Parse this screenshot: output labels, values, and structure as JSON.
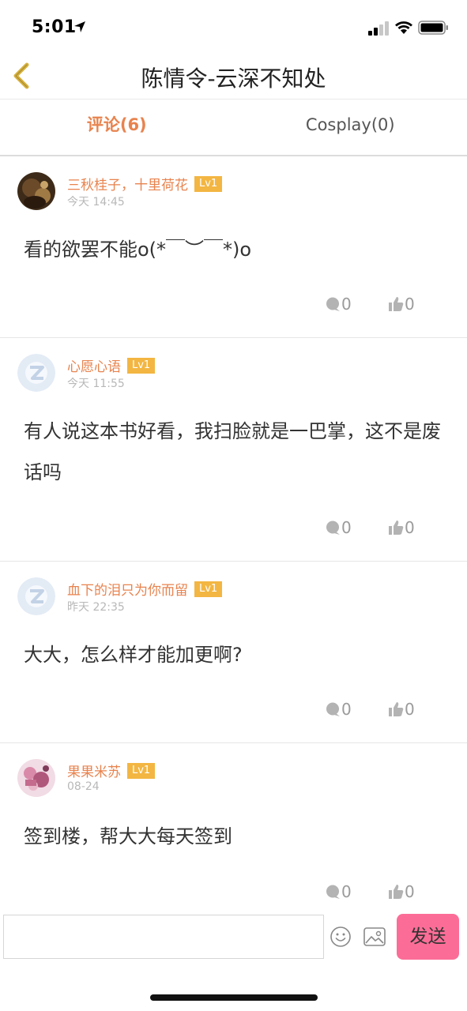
{
  "status": {
    "time": "5:01"
  },
  "nav": {
    "title": "陈情令-云深不知处"
  },
  "tabs": [
    {
      "label": "评论(6)"
    },
    {
      "label": "Cosplay(0)"
    }
  ],
  "comments": [
    {
      "user": "三秋桂子，十里荷花",
      "level": "Lv1",
      "time": "今天 14:45",
      "text": "看的欲罢不能o(*￣︶￣*)o",
      "replies": "0",
      "likes": "0"
    },
    {
      "user": "心愿心语",
      "level": "Lv1",
      "time": "今天 11:55",
      "text": "有人说这本书好看，我扫脸就是一巴掌，这不是废话吗",
      "replies": "0",
      "likes": "0"
    },
    {
      "user": "血下的泪只为你而留",
      "level": "Lv1",
      "time": "昨天 22:35",
      "text": "大大，怎么样才能加更啊?",
      "replies": "0",
      "likes": "0"
    },
    {
      "user": "果果米苏",
      "level": "Lv1",
      "time": "08-24",
      "text": "签到楼，帮大大每天签到",
      "replies": "0",
      "likes": "0"
    }
  ],
  "input": {
    "value": "",
    "placeholder": "",
    "send_label": "发送"
  },
  "colors": {
    "accent": "#e8834e",
    "badge": "#f3b642",
    "send": "#fb6d97"
  }
}
